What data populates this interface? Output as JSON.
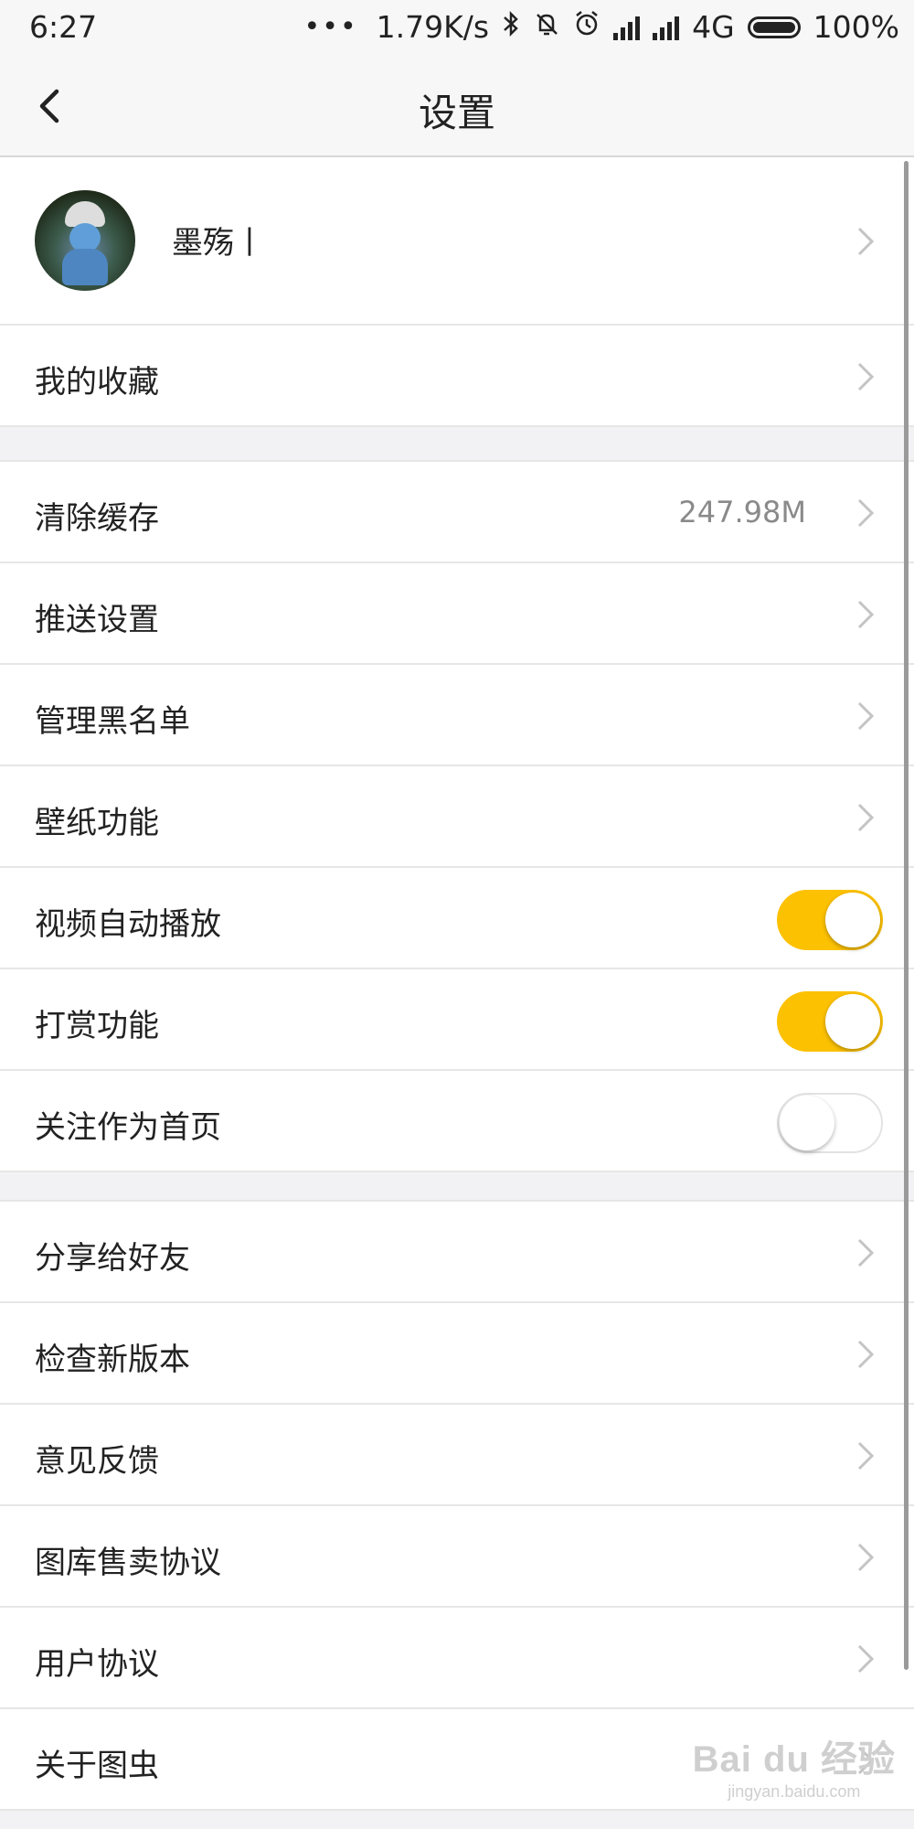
{
  "status_bar": {
    "time": "6:27",
    "dots": "•••",
    "network_speed": "1.79K/s",
    "network_type": "4G",
    "battery": "100%"
  },
  "header": {
    "title": "设置"
  },
  "profile": {
    "name": "墨殇丨"
  },
  "items": {
    "favorites": "我的收藏",
    "clear_cache": "清除缓存",
    "cache_size": "247.98M",
    "push_settings": "推送设置",
    "blacklist": "管理黑名单",
    "wallpaper": "壁纸功能",
    "video_autoplay": "视频自动播放",
    "reward": "打赏功能",
    "follow_home": "关注作为首页",
    "share": "分享给好友",
    "check_update": "检查新版本",
    "feedback": "意见反馈",
    "gallery_agreement": "图库售卖协议",
    "user_agreement": "用户协议",
    "about": "关于图虫"
  },
  "toggles": {
    "video_autoplay": true,
    "reward": true,
    "follow_home": false
  },
  "colors": {
    "toggle_on": "#fcc101",
    "background": "#f2f2f4"
  },
  "watermark": {
    "main": "Bai du 经验",
    "sub": "jingyan.baidu.com"
  }
}
